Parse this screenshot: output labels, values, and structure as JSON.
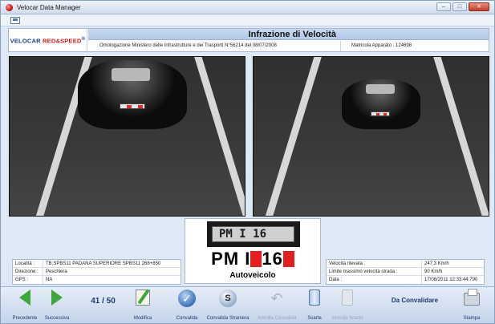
{
  "window": {
    "title": "Velocar Data Manager",
    "controls": [
      "–",
      "□",
      "✕"
    ]
  },
  "header": {
    "brand": {
      "name": "VELOCAR",
      "accent": "RED&SPEED",
      "registered": "®"
    },
    "title": "Infrazione di Velocità",
    "omologazione": "Omologazione Ministero delle Infrastrutture e dei Trasporti N°56214 del 08/07/2008",
    "matricola": "Matricola Apparato : 124698"
  },
  "plate": {
    "crop_text": "PM I 16",
    "large_part1": "PM I",
    "large_part2": "16",
    "vehicle_type": "Autoveicolo"
  },
  "location_info": [
    {
      "label": "Località :",
      "value": "TB;SPBS11 PADANA SUPERIORE SPBS11 268+850"
    },
    {
      "label": "Direzione :",
      "value": "Peschiera"
    },
    {
      "label": "GPS :",
      "value": "NA"
    }
  ],
  "speed_info": [
    {
      "label": "Velocità rilevata :",
      "value": "247,3 Km/h"
    },
    {
      "label": "Limite massimo velocità strada :",
      "value": "90 Km/h"
    },
    {
      "label": "Data :",
      "value": "17/08/2011 12:33:44:790"
    }
  ],
  "bottom": {
    "prev": "Precedente",
    "next": "Successiva",
    "counter": "41 / 50",
    "edit": "Modifica",
    "validate": "Convalida",
    "validate_foreign": "Convalida Straniera",
    "cancel_validate": "Annulla Convalida",
    "discard": "Scarta",
    "cancel_discard": "Annulla Scarto",
    "status": "Da Convalidare",
    "print": "Stampa"
  },
  "colors": {
    "accent": "#1d3a6e",
    "plate_mask": "#e31f1f",
    "banner": "#b3c9e7"
  }
}
